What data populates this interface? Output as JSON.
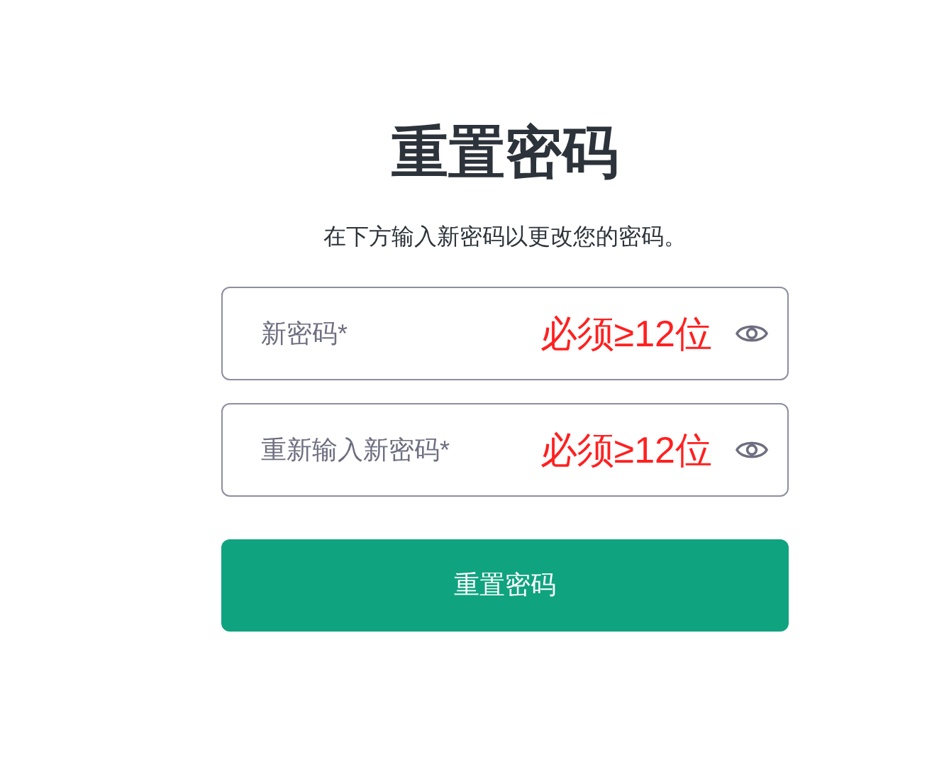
{
  "title": "重置密码",
  "subtitle": "在下方输入新密码以更改您的密码。",
  "fields": [
    {
      "placeholder": "新密码*",
      "note": "必须≥12位"
    },
    {
      "placeholder": "重新输入新密码*",
      "note": "必须≥12位"
    }
  ],
  "submit_button": "重置密码"
}
